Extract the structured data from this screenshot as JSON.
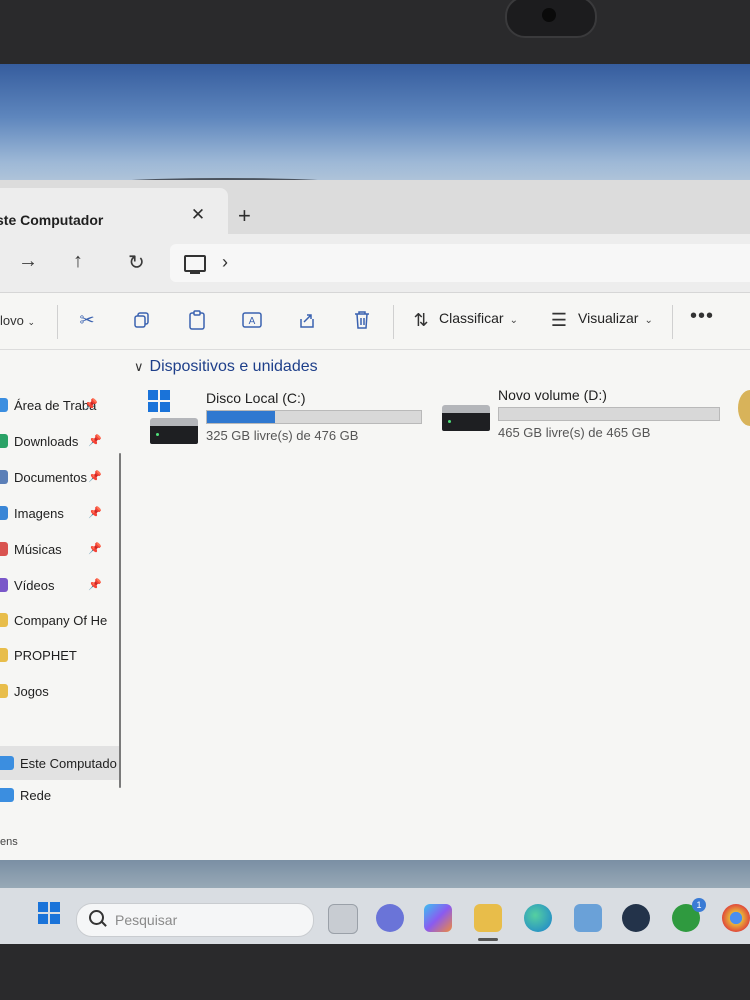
{
  "window": {
    "tab_title": "ste Computador",
    "tab_close": "✕",
    "new_tab": "+"
  },
  "nav": {
    "forward": "→",
    "up": "↑",
    "refresh": "↻",
    "breadcrumb_chevron": "›"
  },
  "toolbar": {
    "new_label": "lovo",
    "sort_label": "Classificar",
    "view_label": "Visualizar",
    "more_label": "•••"
  },
  "sidebar": {
    "items": [
      {
        "label": "Área de Traba",
        "icon": "desktop-icon",
        "pinned": true
      },
      {
        "label": "Downloads",
        "icon": "downloads-icon",
        "pinned": true
      },
      {
        "label": "Documentos",
        "icon": "documents-icon",
        "pinned": true
      },
      {
        "label": "Imagens",
        "icon": "pictures-icon",
        "pinned": true
      },
      {
        "label": "Músicas",
        "icon": "music-icon",
        "pinned": true
      },
      {
        "label": "Vídeos",
        "icon": "videos-icon",
        "pinned": true
      },
      {
        "label": "Company Of He",
        "icon": "folder-icon",
        "pinned": false
      },
      {
        "label": "PROPHET",
        "icon": "folder-icon",
        "pinned": false
      },
      {
        "label": "Jogos",
        "icon": "folder-icon",
        "pinned": false
      },
      {
        "label": "Este Computado",
        "icon": "computer-icon",
        "pinned": false
      },
      {
        "label": "Rede",
        "icon": "network-icon",
        "pinned": false
      }
    ],
    "status_text": "ens"
  },
  "main": {
    "section_title": "Dispositivos e unidades",
    "drives": [
      {
        "name": "Disco Local (C:)",
        "free_text": "325 GB livre(s) de 476 GB",
        "used_fraction": 0.32
      },
      {
        "name": "Novo volume (D:)",
        "free_text": "465 GB livre(s) de 465 GB",
        "used_fraction": 0.0
      }
    ]
  },
  "taskbar": {
    "search_placeholder": "Pesquisar",
    "notification_count": "1"
  },
  "colors": {
    "accent": "#2f78d0",
    "section_title": "#1e3f8a"
  }
}
